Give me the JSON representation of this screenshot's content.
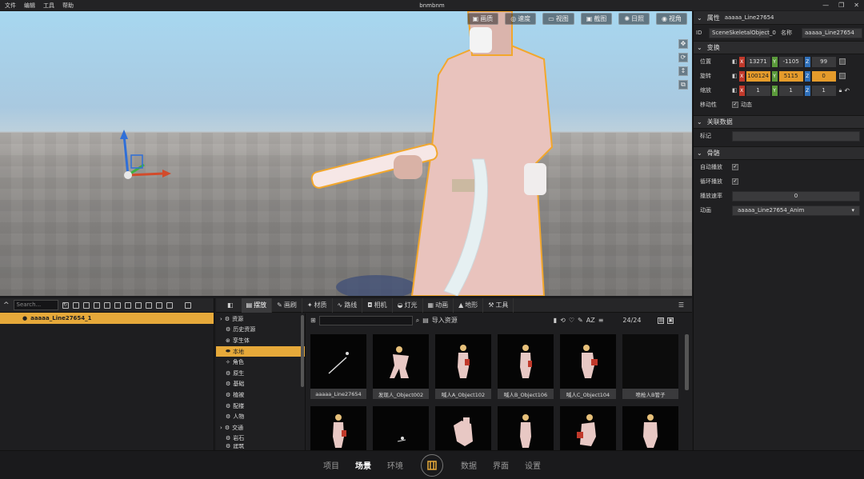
{
  "window": {
    "title": "bnmbnm",
    "menu": [
      "文件",
      "编辑",
      "工具",
      "帮助"
    ]
  },
  "viewport": {
    "toolbar": [
      "画质",
      "速度",
      "视图",
      "截图",
      "日照",
      "视角"
    ]
  },
  "properties": {
    "header": "属性",
    "object_name": "aaaaa_Line27654",
    "id_label": "ID",
    "id_value": "SceneSkeletalObject_0",
    "name_label": "名称",
    "name_value": "aaaaa_Line27654",
    "transform": {
      "title": "变换",
      "position": {
        "label": "位置",
        "x": "13271",
        "y": "-1105",
        "z": "99"
      },
      "rotation": {
        "label": "旋转",
        "x": "100124",
        "y": "5115",
        "z": "0"
      },
      "scale": {
        "label": "缩放",
        "x": "1",
        "y": "1",
        "z": "1"
      },
      "mobility": {
        "label": "移动性",
        "value": "动态"
      }
    },
    "related": {
      "title": "关联数据",
      "tag_label": "标记",
      "tag_value": ""
    },
    "skeleton": {
      "title": "骨骼",
      "autoplay_label": "自动播放",
      "loop_label": "循环播放",
      "speed_label": "播放速率",
      "speed_value": "0",
      "anim_label": "动画",
      "anim_value": "aaaaa_Line27654_Anim"
    }
  },
  "outliner": {
    "search_placeholder": "Search...",
    "items": [
      {
        "label": "aaaaa_Line27654_1"
      }
    ]
  },
  "content": {
    "tabs": [
      "摆放",
      "画刷",
      "材质",
      "路线",
      "相机",
      "灯光",
      "动画",
      "地形",
      "工具"
    ],
    "tree": [
      "资源",
      "历史资源",
      "孪生体",
      "本地",
      "角色",
      "原生",
      "基础",
      "植被",
      "配楼",
      "人物",
      "交通",
      "岩石",
      "建筑"
    ],
    "import_label": "导入资源",
    "page_count": "24/24",
    "assets": [
      "aaaaa_Line27654",
      "发现人_Object002",
      "喊人A_Object102",
      "喊人B_Object106",
      "喊人C_Object104",
      "喷枪人B管子",
      "",
      "",
      "",
      "",
      "",
      ""
    ]
  },
  "bottom_nav": [
    "项目",
    "场景",
    "环境",
    "数据",
    "界面",
    "设置"
  ],
  "colors": {
    "accent": "#e6a93a",
    "x_axis": "#c0392b",
    "y_axis": "#5a9a3a",
    "z_axis": "#2f6fb8"
  }
}
